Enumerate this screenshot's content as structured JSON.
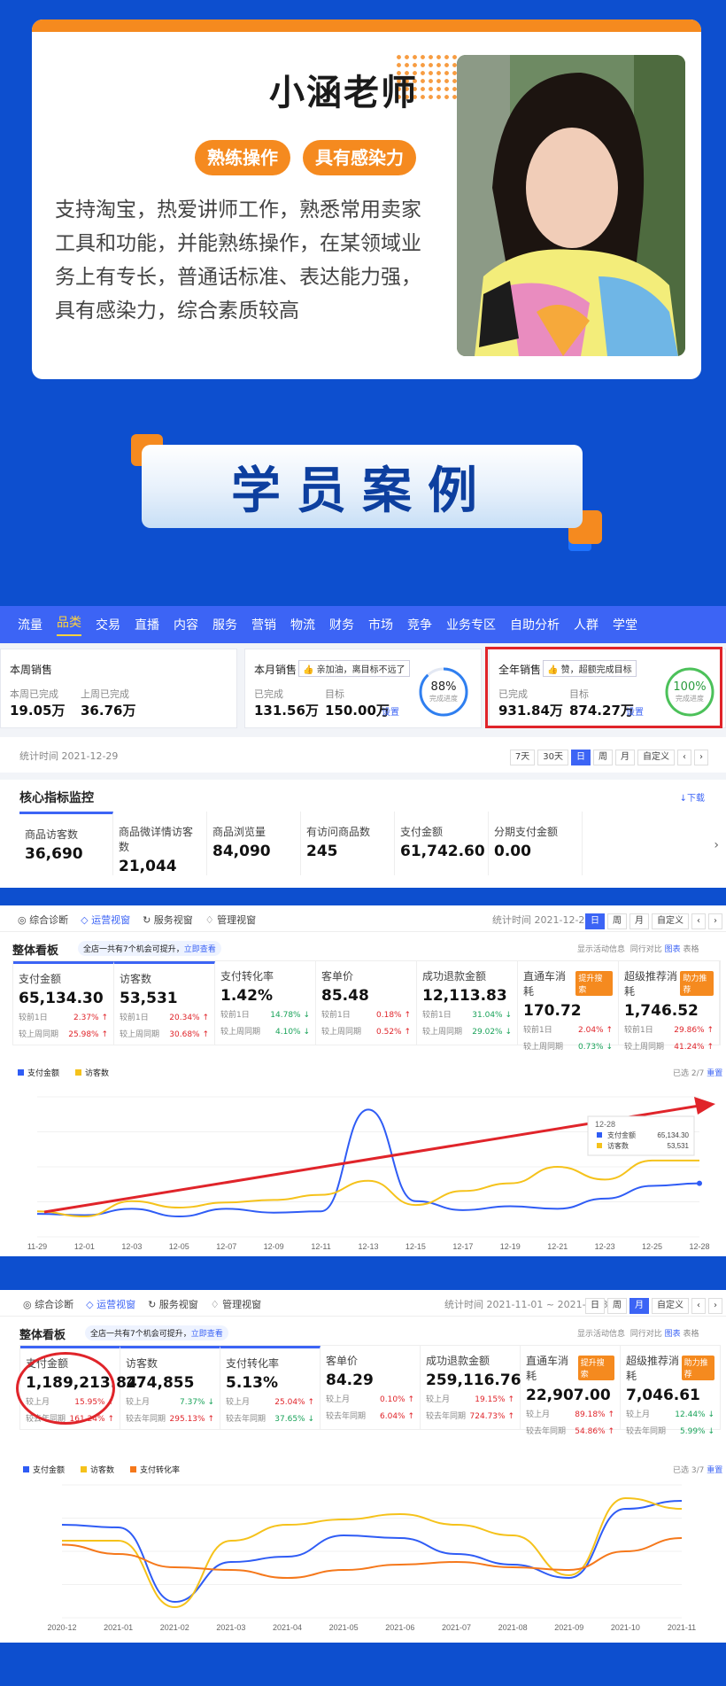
{
  "teacher": {
    "name": "小涵老师",
    "tags": [
      "熟练操作",
      "具有感染力"
    ],
    "description": "支持淘宝，热爱讲师工作，熟悉常用卖家工具和功能，并能熟练操作，在某领域业务上有专长，普通话标准、表达能力强，具有感染力，综合素质较高"
  },
  "banner": {
    "title": "学员案例"
  },
  "colors": {
    "bg": "#0d4fcf",
    "accent": "#f58a1f",
    "nav": "#3c64f5",
    "red": "#e0242a"
  },
  "panel1": {
    "nav": [
      "流量",
      "品类",
      "交易",
      "直播",
      "内容",
      "服务",
      "营销",
      "物流",
      "财务",
      "市场",
      "竞争",
      "业务专区",
      "自助分析",
      "人群",
      "学堂"
    ],
    "nav_active": "品类",
    "week": {
      "title": "本周销售",
      "cur_label": "本周已完成",
      "cur": "19.05万",
      "prev_label": "上周已完成",
      "prev": "36.76万"
    },
    "month": {
      "title": "本月销售",
      "badge": "亲加油，离目标不远了",
      "done_label": "已完成",
      "done": "131.56万",
      "target_label": "目标",
      "target": "150.00万",
      "set": "设置",
      "pct": "88%",
      "pct_label": "完成进度",
      "progress": 0.88
    },
    "year": {
      "title": "全年销售",
      "badge": "赞，超额完成目标",
      "done_label": "已完成",
      "done": "931.84万",
      "target_label": "目标",
      "target": "874.27万",
      "set": "设置",
      "pct": "100%",
      "pct_label": "完成进度",
      "progress": 1.0
    },
    "stat_time": "统计时间 2021-12-29",
    "ranges": [
      "7天",
      "30天",
      "日",
      "周",
      "月",
      "自定义"
    ],
    "range_active": "日",
    "core_title": "核心指标监控",
    "download": "下载",
    "metrics": [
      {
        "label": "商品访客数",
        "value": "36,690"
      },
      {
        "label": "商品微详情访客数",
        "value": "21,044"
      },
      {
        "label": "商品浏览量",
        "value": "84,090"
      },
      {
        "label": "有访问商品数",
        "value": "245"
      },
      {
        "label": "支付金额",
        "value": "61,742.60"
      },
      {
        "label": "分期支付金额",
        "value": "0.00"
      }
    ]
  },
  "panel2": {
    "tabs": [
      "综合诊断",
      "运营视窗",
      "服务视窗",
      "管理视窗"
    ],
    "tab_active": "运营视窗",
    "stat_time": "统计时间 2021-12-28",
    "ranges": [
      "日",
      "周",
      "月",
      "自定义"
    ],
    "range_active": "日",
    "board_title": "整体看板",
    "hint": "全店一共有7个机会可提升，",
    "hint_link": "立即查看",
    "opts": [
      "显示活动信息",
      "同行对比"
    ],
    "views": [
      "图表",
      "表格"
    ],
    "selected": "已选 2/7",
    "reset": "重置",
    "kpis": [
      {
        "label": "支付金额",
        "value": "65,134.30",
        "r1": "较前1日",
        "v1": "2.37%",
        "r2": "较上周同期",
        "v2": "25.98%",
        "d1": "up",
        "d2": "up",
        "chip": ""
      },
      {
        "label": "访客数",
        "value": "53,531",
        "r1": "较前1日",
        "v1": "20.34%",
        "r2": "较上周同期",
        "v2": "30.68%",
        "d1": "up",
        "d2": "up",
        "chip": ""
      },
      {
        "label": "支付转化率",
        "value": "1.42%",
        "r1": "较前1日",
        "v1": "14.78%",
        "r2": "较上周同期",
        "v2": "4.10%",
        "d1": "down",
        "d2": "down",
        "chip": ""
      },
      {
        "label": "客单价",
        "value": "85.48",
        "r1": "较前1日",
        "v1": "0.18%",
        "r2": "较上周同期",
        "v2": "0.52%",
        "d1": "up",
        "d2": "up",
        "chip": ""
      },
      {
        "label": "成功退款金额",
        "value": "12,113.83",
        "r1": "较前1日",
        "v1": "31.04%",
        "r2": "较上周同期",
        "v2": "29.02%",
        "d1": "down",
        "d2": "down",
        "chip": ""
      },
      {
        "label": "直通车消耗",
        "value": "170.72",
        "r1": "较前1日",
        "v1": "2.04%",
        "r2": "较上周同期",
        "v2": "0.73%",
        "d1": "up",
        "d2": "down",
        "chip": "提升搜索"
      },
      {
        "label": "超级推荐消耗",
        "value": "1,746.52",
        "r1": "较前1日",
        "v1": "29.86%",
        "r2": "较上周同期",
        "v2": "41.24%",
        "d1": "up",
        "d2": "up",
        "chip": "助力推荐"
      }
    ],
    "tooltip": {
      "date": "12-28",
      "items": [
        {
          "name": "支付金额",
          "value": "65,134.30"
        },
        {
          "name": "访客数",
          "value": "53,531"
        }
      ]
    }
  },
  "panel3": {
    "tabs": [
      "综合诊断",
      "运营视窗",
      "服务视窗",
      "管理视窗"
    ],
    "tab_active": "运营视窗",
    "stat_time": "统计时间 2021-11-01 ~ 2021-11-30",
    "ranges": [
      "日",
      "周",
      "月",
      "自定义"
    ],
    "range_active": "月",
    "board_title": "整体看板",
    "hint": "全店一共有7个机会可提升，",
    "hint_link": "立即查看",
    "opts": [
      "显示活动信息",
      "同行对比"
    ],
    "views": [
      "图表",
      "表格"
    ],
    "selected": "已选 3/7",
    "reset": "重置",
    "kpis": [
      {
        "label": "支付金额",
        "value": "1,189,213.84",
        "r1": "较上月",
        "v1": "15.95%",
        "r2": "较去年同期",
        "v2": "161.24%",
        "d1": "up",
        "d2": "up",
        "chip": ""
      },
      {
        "label": "访客数",
        "value": "274,855",
        "r1": "较上月",
        "v1": "7.37%",
        "r2": "较去年同期",
        "v2": "295.13%",
        "d1": "down",
        "d2": "up",
        "chip": ""
      },
      {
        "label": "支付转化率",
        "value": "5.13%",
        "r1": "较上月",
        "v1": "25.04%",
        "r2": "较去年同期",
        "v2": "37.65%",
        "d1": "up",
        "d2": "down",
        "chip": ""
      },
      {
        "label": "客单价",
        "value": "84.29",
        "r1": "较上月",
        "v1": "0.10%",
        "r2": "较去年同期",
        "v2": "6.04%",
        "d1": "up",
        "d2": "up",
        "chip": ""
      },
      {
        "label": "成功退款金额",
        "value": "259,116.76",
        "r1": "较上月",
        "v1": "19.15%",
        "r2": "较去年同期",
        "v2": "724.73%",
        "d1": "up",
        "d2": "up",
        "chip": ""
      },
      {
        "label": "直通车消耗",
        "value": "22,907.00",
        "r1": "较上月",
        "v1": "89.18%",
        "r2": "较去年同期",
        "v2": "54.86%",
        "d1": "up",
        "d2": "up",
        "chip": "提升搜索"
      },
      {
        "label": "超级推荐消耗",
        "value": "7,046.61",
        "r1": "较上月",
        "v1": "12.44%",
        "r2": "较去年同期",
        "v2": "5.99%",
        "d1": "down",
        "d2": "down",
        "chip": "助力推荐"
      }
    ]
  },
  "chart_data": [
    {
      "type": "line",
      "x": [
        "11-29",
        "12-01",
        "12-03",
        "12-05",
        "12-07",
        "12-09",
        "12-11",
        "12-13",
        "12-15",
        "12-17",
        "12-19",
        "12-21",
        "12-23",
        "12-25",
        "12-28"
      ],
      "series": [
        {
          "name": "支付金额",
          "color": "#2f5cf5",
          "values": [
            18,
            17,
            22,
            16,
            22,
            19,
            20,
            100,
            28,
            21,
            24,
            22,
            30,
            40,
            42
          ]
        },
        {
          "name": "访客数",
          "color": "#f5c21b",
          "values": [
            20,
            16,
            28,
            23,
            27,
            29,
            33,
            44,
            25,
            36,
            42,
            55,
            45,
            60,
            60
          ]
        }
      ],
      "ylim": [
        0,
        110
      ]
    },
    {
      "type": "line",
      "x": [
        "2020-12",
        "2021-01",
        "2021-02",
        "2021-03",
        "2021-04",
        "2021-05",
        "2021-06",
        "2021-07",
        "2021-08",
        "2021-09",
        "2021-10",
        "2021-11"
      ],
      "series": [
        {
          "name": "支付金额",
          "color": "#2f5cf5",
          "values": [
            70,
            68,
            12,
            42,
            46,
            62,
            60,
            48,
            40,
            30,
            82,
            88
          ]
        },
        {
          "name": "访客数",
          "color": "#f5c21b",
          "values": [
            58,
            58,
            8,
            58,
            70,
            74,
            78,
            70,
            62,
            32,
            90,
            82
          ]
        },
        {
          "name": "支付转化率",
          "color": "#f5781b",
          "values": [
            55,
            48,
            38,
            36,
            30,
            36,
            40,
            42,
            38,
            36,
            50,
            60
          ]
        }
      ],
      "ylim": [
        0,
        100
      ]
    }
  ]
}
